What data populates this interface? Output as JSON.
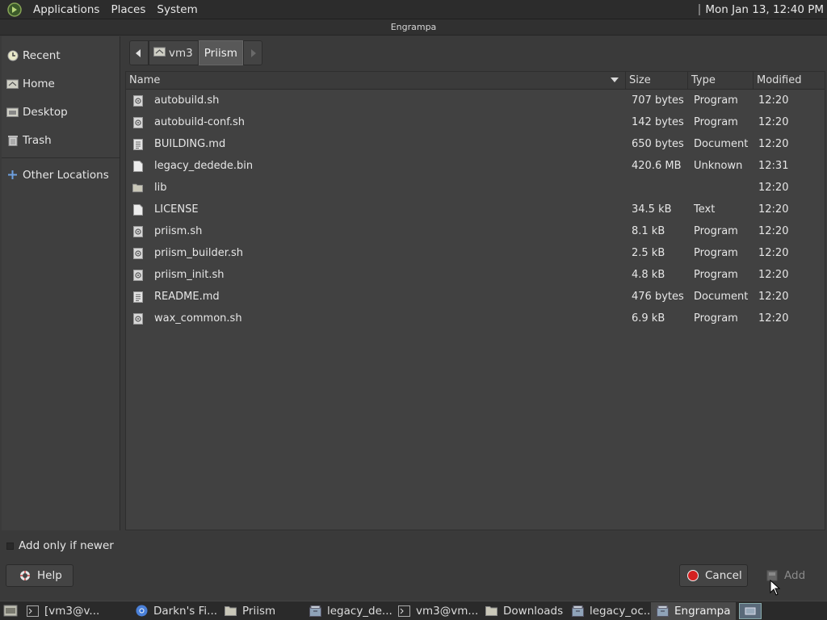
{
  "top_panel": {
    "menu": [
      "Applications",
      "Places",
      "System"
    ],
    "clock": "Mon Jan 13, 12:40 PM"
  },
  "window": {
    "title": "Engrampa"
  },
  "sidebar": {
    "items": [
      {
        "label": "Recent",
        "icon": "clock-icon"
      },
      {
        "label": "Home",
        "icon": "home-icon"
      },
      {
        "label": "Desktop",
        "icon": "desktop-icon"
      },
      {
        "label": "Trash",
        "icon": "trash-icon"
      }
    ],
    "other": {
      "label": "Other Locations",
      "icon": "plus-icon"
    }
  },
  "pathbar": {
    "segments": [
      "vm3",
      "Priism"
    ],
    "active": "Priism"
  },
  "filelist": {
    "columns": {
      "name": "Name",
      "size": "Size",
      "type": "Type",
      "modified": "Modified"
    },
    "sort": {
      "column": "Name",
      "direction": "descending"
    },
    "rows": [
      {
        "name": "autobuild.sh",
        "size": "707 bytes",
        "type": "Program",
        "modified": "12:20",
        "icon": "script-icon"
      },
      {
        "name": "autobuild-conf.sh",
        "size": "142 bytes",
        "type": "Program",
        "modified": "12:20",
        "icon": "script-icon"
      },
      {
        "name": "BUILDING.md",
        "size": "650 bytes",
        "type": "Document",
        "modified": "12:20",
        "icon": "document-icon"
      },
      {
        "name": "legacy_dedede.bin",
        "size": "420.6 MB",
        "type": "Unknown",
        "modified": "12:31",
        "icon": "file-icon"
      },
      {
        "name": "lib",
        "size": "",
        "type": "",
        "modified": "12:20",
        "icon": "folder-icon"
      },
      {
        "name": "LICENSE",
        "size": "34.5 kB",
        "type": "Text",
        "modified": "12:20",
        "icon": "text-icon"
      },
      {
        "name": "priism.sh",
        "size": "8.1 kB",
        "type": "Program",
        "modified": "12:20",
        "icon": "script-icon"
      },
      {
        "name": "priism_builder.sh",
        "size": "2.5 kB",
        "type": "Program",
        "modified": "12:20",
        "icon": "script-icon"
      },
      {
        "name": "priism_init.sh",
        "size": "4.8 kB",
        "type": "Program",
        "modified": "12:20",
        "icon": "script-icon"
      },
      {
        "name": "README.md",
        "size": "476 bytes",
        "type": "Document",
        "modified": "12:20",
        "icon": "document-icon"
      },
      {
        "name": "wax_common.sh",
        "size": "6.9 kB",
        "type": "Program",
        "modified": "12:20",
        "icon": "script-icon"
      }
    ]
  },
  "options": {
    "add_only_if_newer": "Add only if newer"
  },
  "buttons": {
    "help": "Help",
    "cancel": "Cancel",
    "add": "Add"
  },
  "taskbar": {
    "tasks": [
      {
        "label": "[vm3@v...",
        "icon": "terminal-icon",
        "active": false
      },
      {
        "label": "Darkn's Fi...",
        "icon": "chrome-icon",
        "active": false
      },
      {
        "label": "Priism",
        "icon": "folder-icon",
        "active": false
      },
      {
        "label": "legacy_de...",
        "icon": "archive-icon",
        "active": false
      },
      {
        "label": "vm3@vm...",
        "icon": "terminal-icon",
        "active": false
      },
      {
        "label": "Downloads",
        "icon": "folder-icon",
        "active": false
      },
      {
        "label": "legacy_oc...",
        "icon": "archive-icon",
        "active": false
      },
      {
        "label": "Engrampa",
        "icon": "archive-icon",
        "active": true
      }
    ]
  },
  "colors": {
    "background": "#3a3a3a",
    "panel": "#2c2c2c",
    "cancel_red": "#d42020"
  }
}
